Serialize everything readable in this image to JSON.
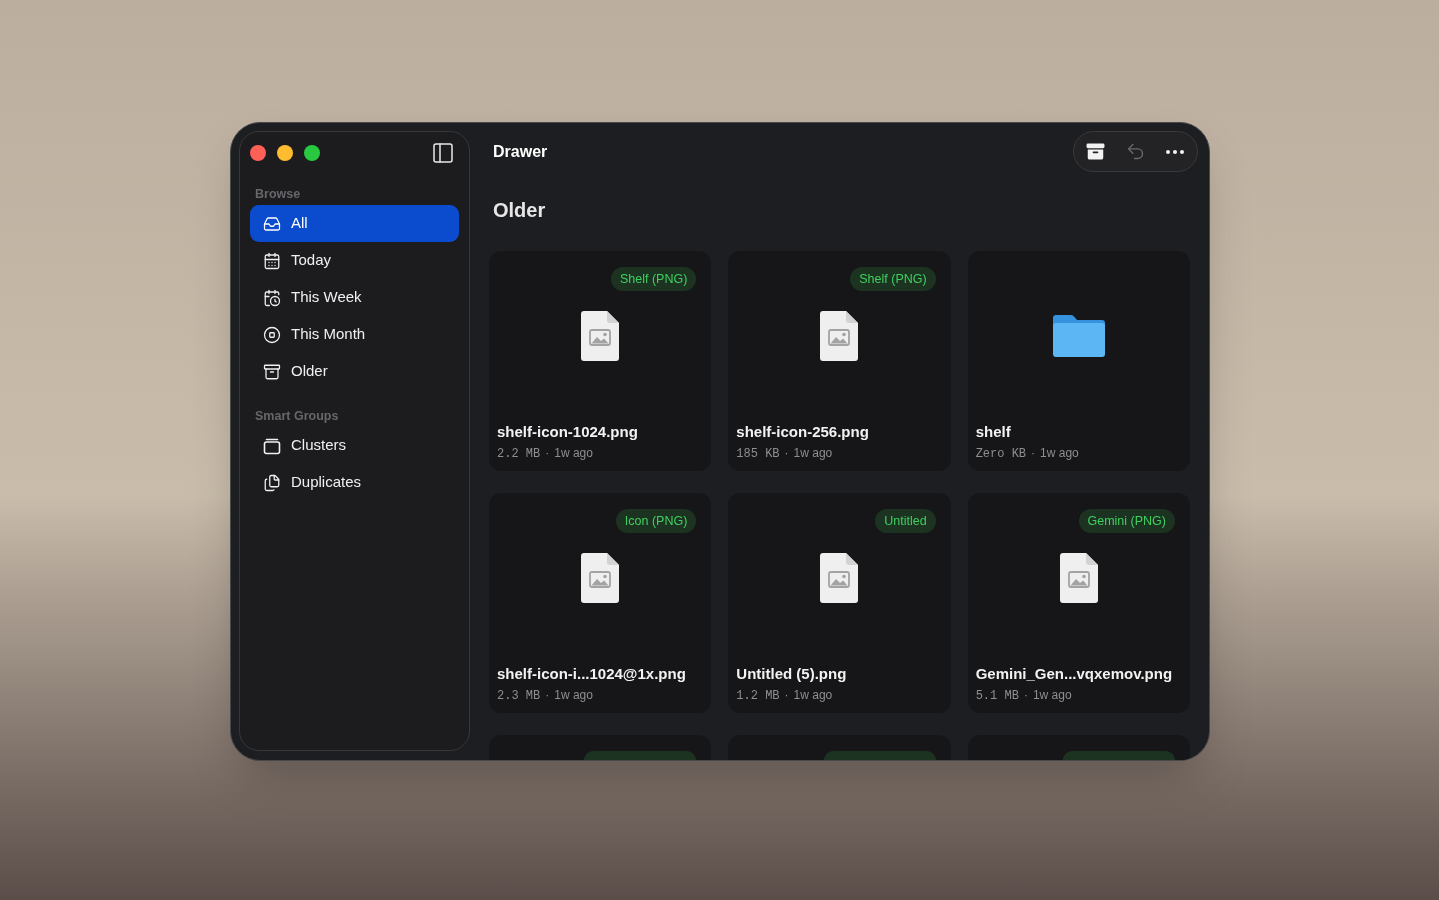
{
  "window": {
    "title": "Drawer"
  },
  "sidebar": {
    "sections": [
      {
        "title": "Browse",
        "items": [
          {
            "label": "All",
            "selected": true
          },
          {
            "label": "Today",
            "selected": false
          },
          {
            "label": "This Week",
            "selected": false
          },
          {
            "label": "This Month",
            "selected": false
          },
          {
            "label": "Older",
            "selected": false
          }
        ]
      },
      {
        "title": "Smart Groups",
        "items": [
          {
            "label": "Clusters",
            "selected": false
          },
          {
            "label": "Duplicates",
            "selected": false
          }
        ]
      }
    ]
  },
  "toolbar": {
    "buttons": [
      {
        "kind": "archive",
        "disabled": false
      },
      {
        "kind": "undo",
        "disabled": true
      },
      {
        "kind": "more",
        "disabled": false
      }
    ]
  },
  "section": {
    "title": "Older"
  },
  "cards": [
    {
      "kind": "image",
      "tag": "Shelf (PNG)",
      "name": "shelf-icon-1024.png",
      "size": "2.2 MB",
      "separator": "·",
      "age": "1w ago"
    },
    {
      "kind": "image",
      "tag": "Shelf (PNG)",
      "name": "shelf-icon-256.png",
      "size": "185 KB",
      "separator": "·",
      "age": "1w ago"
    },
    {
      "kind": "folder",
      "name": "shelf",
      "size": "Zero KB",
      "separator": "·",
      "age": "1w ago"
    },
    {
      "kind": "image",
      "tag": "Icon (PNG)",
      "name": "shelf-icon-i...1024@1x.png",
      "size": "2.3 MB",
      "separator": "·",
      "age": "1w ago"
    },
    {
      "kind": "image",
      "tag": "Untitled",
      "name": "Untitled (5).png",
      "size": "1.2 MB",
      "separator": "·",
      "age": "1w ago"
    },
    {
      "kind": "image",
      "tag": "Gemini (PNG)",
      "name": "Gemini_Gen...vqxemov.png",
      "size": "5.1 MB",
      "separator": "·",
      "age": "1w ago"
    },
    {
      "kind": "cut"
    },
    {
      "kind": "cut"
    },
    {
      "kind": "cut"
    }
  ]
}
